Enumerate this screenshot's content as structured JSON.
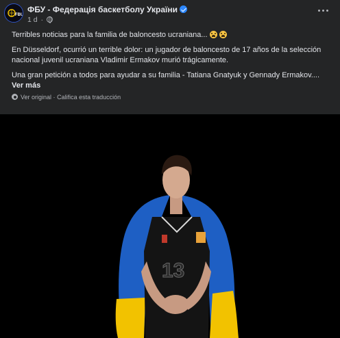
{
  "header": {
    "page_name": "ФБУ - Федерація баскетболу України",
    "time": "1 d",
    "dot": "·"
  },
  "post": {
    "line1": "Terribles noticias para la familia de baloncesto ucraniana...",
    "paragraph2": "En Düsseldorf, ocurrió un terrible dolor: un jugador de baloncesto de 17 años de la selección nacional juvenil ucraniana Vladimir Ermakov murió trágicamente.",
    "paragraph3": "Una gran petición a todos para ayudar a su familia - Tatiana Gnatyuk y Gennady Ermakov....",
    "see_more": "Ver más"
  },
  "translation": {
    "view_original": "Ver original",
    "separator": "·",
    "rate": "Califica esta traducción"
  },
  "icons": {
    "avatar": "fbu-logo",
    "verified": "verified-badge-icon",
    "privacy": "globe-icon",
    "more": "more-options-icon",
    "emoji": "fearful-face-emoji",
    "translate": "gear-icon"
  },
  "colors": {
    "background": "#242526",
    "text": "#e4e6eb",
    "secondary_text": "#b0b3b8",
    "verified": "#2d88ff",
    "flag_blue": "#1e5fc4",
    "flag_yellow": "#f2c200"
  }
}
